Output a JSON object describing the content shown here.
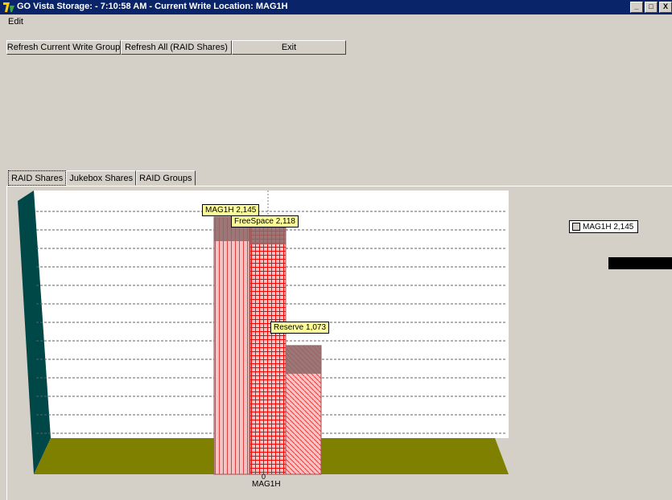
{
  "window": {
    "title": "GO Vista Storage:  - 7:10:58 AM - Current Write Location: MAG1H",
    "controls": [
      "_",
      "□",
      "X"
    ]
  },
  "menu": {
    "edit": "Edit"
  },
  "toolbar": {
    "refresh_current": "Refresh Current Write Group",
    "refresh_all": "Refresh All (RAID Shares)",
    "exit": "Exit"
  },
  "tabs": [
    "RAID Shares",
    "Jukebox Shares",
    "RAID Groups"
  ],
  "chart": {
    "tooltips": {
      "mag1h": "MAG1H 2,145",
      "freespace": "FreeSpace  2,118",
      "reserve": "Reserve  1,073"
    },
    "legend": "MAG1H 2,145",
    "x_tick": "0",
    "x_label": "MAG1H",
    "colors": {
      "left_wall": "#004848",
      "floor": "#808000",
      "bar_fill": "#f4c4c4",
      "bar_lines": "#ff0000",
      "bar_top": "#8c6a6a"
    }
  },
  "chart_data": {
    "type": "bar",
    "categories": [
      "MAG1H"
    ],
    "series": [
      {
        "name": "MAG1H",
        "values": [
          2145
        ]
      },
      {
        "name": "FreeSpace",
        "values": [
          2118
        ]
      },
      {
        "name": "Reserve",
        "values": [
          1073
        ]
      }
    ],
    "ylim": [
      0,
      2400
    ],
    "grid": true,
    "legend_position": "right"
  }
}
